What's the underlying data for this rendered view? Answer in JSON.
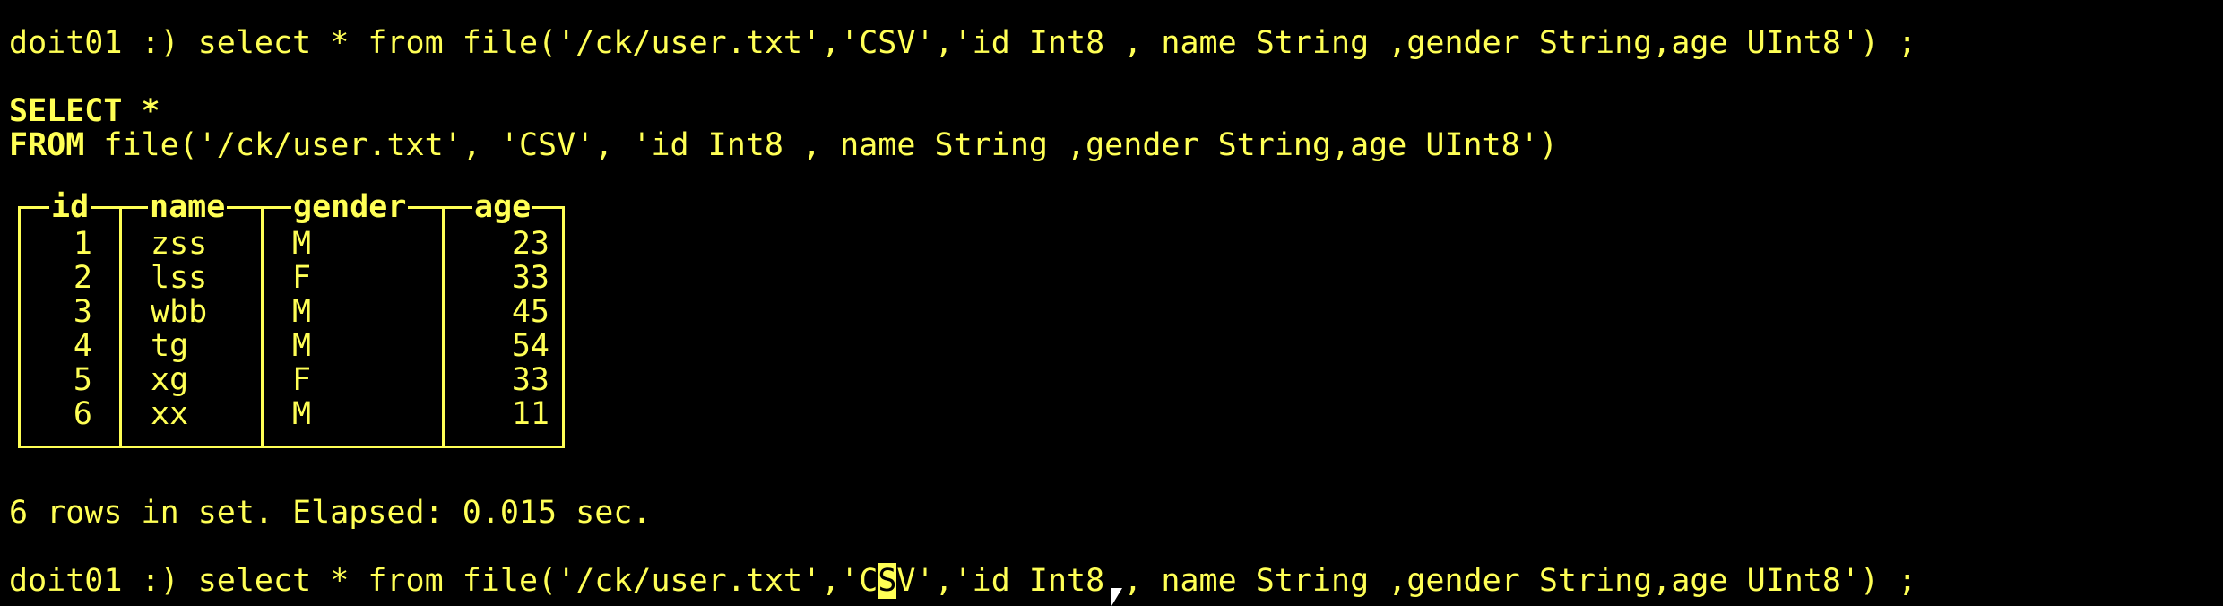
{
  "terminal": {
    "colors": {
      "background": "#000000",
      "foreground": "#FFFF55"
    },
    "prompt_line_1": {
      "prompt": "doit01 :) ",
      "command": "select * from file('/ck/user.txt','CSV','id Int8 , name String ,gender String,age UInt8') ;"
    },
    "formatted_query": {
      "line1": "SELECT *",
      "line2_keyword": "FROM",
      "line2_rest": " file('/ck/user.txt', 'CSV', 'id Int8 , name String ,gender String,age UInt8')"
    },
    "result": {
      "columns": [
        "id",
        "name",
        "gender",
        "age"
      ],
      "rows": [
        {
          "id": "1",
          "name": "zss",
          "gender": "M",
          "age": "23"
        },
        {
          "id": "2",
          "name": "lss",
          "gender": "F",
          "age": "33"
        },
        {
          "id": "3",
          "name": "wbb",
          "gender": "M",
          "age": "45"
        },
        {
          "id": "4",
          "name": "tg",
          "gender": "M",
          "age": "54"
        },
        {
          "id": "5",
          "name": "xg",
          "gender": "F",
          "age": "33"
        },
        {
          "id": "6",
          "name": "xx",
          "gender": "M",
          "age": "11"
        }
      ]
    },
    "summary": "6 rows in set. Elapsed: 0.015 sec.",
    "prompt_line_2": {
      "prompt": "doit01 :) ",
      "before_cursor": "select * from file('/ck/user.txt','C",
      "cursor_char": "S",
      "after_cursor": "V','id Int8 , name String ,gender String,age UInt8') ;"
    }
  }
}
